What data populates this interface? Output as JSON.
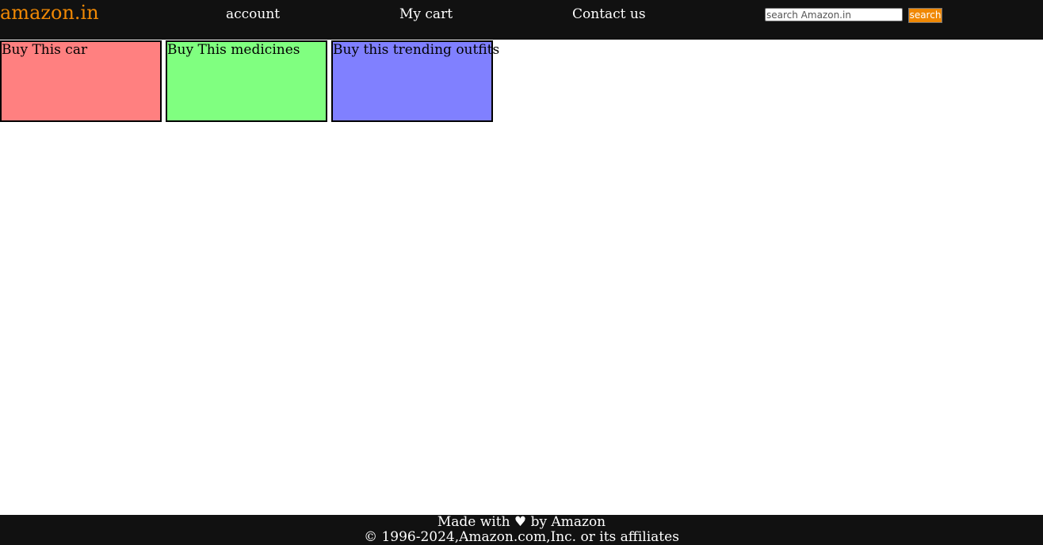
{
  "header": {
    "logo_text": "amazon.in",
    "nav": {
      "account": "account",
      "cart": "My cart",
      "contact": "Contact us"
    },
    "search": {
      "placeholder": "search Amazon.in",
      "value": "",
      "button_label": "search"
    }
  },
  "cards": [
    {
      "label": "Buy This car",
      "color": "#ff8080"
    },
    {
      "label": "Buy This medicines",
      "color": "#80ff80"
    },
    {
      "label": "Buy this trending outfits",
      "color": "#8080ff"
    }
  ],
  "footer": {
    "line1": "Made with ♥ by Amazon",
    "line2": "© 1996-2024,Amazon.com,Inc. or its affiliates"
  },
  "colors": {
    "navbar_bg": "#111111",
    "brand_accent": "#f08804"
  }
}
